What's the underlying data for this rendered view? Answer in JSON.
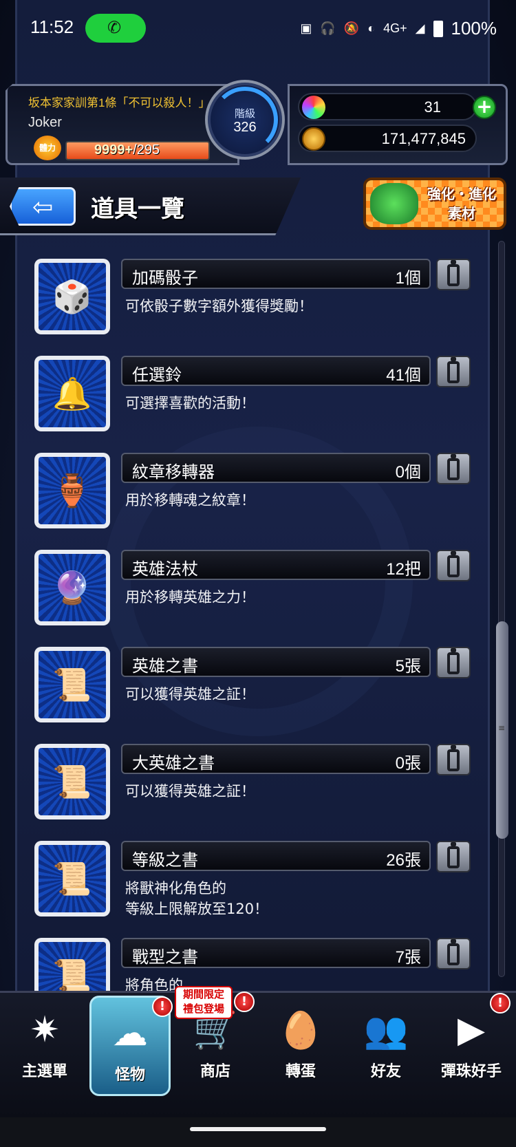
{
  "status_bar": {
    "time": "11:52",
    "battery": "100%",
    "signal_text": "4G+",
    "icons": [
      "call-icon",
      "auto-hd-icon",
      "headphones-icon",
      "mute-bell-icon",
      "volte-icon",
      "signal-icon",
      "battery-icon"
    ]
  },
  "player": {
    "motto": "坂本家家訓第1條「不可以殺人！」",
    "name": "Joker",
    "stamina_icon_text": "體力",
    "stamina_current": "9999+",
    "stamina_max": "/295",
    "rank_label": "階級",
    "rank": "326"
  },
  "resources": {
    "orbs": "31",
    "gold": "171,477,845",
    "plus_label": "+"
  },
  "title_bar": {
    "back_glyph": "⇦",
    "title": "道具一覽"
  },
  "evolve_button": {
    "line1": "強化・進化",
    "line2": "素材"
  },
  "items": [
    {
      "name": "加碼骰子",
      "count": "1個",
      "desc": "可依骰子數字額外獲得獎勵！",
      "icon": "dice-icon",
      "glyph": "🎲"
    },
    {
      "name": "任選鈴",
      "count": "41個",
      "desc": "可選擇喜歡的活動！",
      "icon": "bell-icon",
      "glyph": "🔔"
    },
    {
      "name": "紋章移轉器",
      "count": "0個",
      "desc": "用於移轉魂之紋章！",
      "icon": "emblem-transfer-icon",
      "glyph": "🏺"
    },
    {
      "name": "英雄法杖",
      "count": "12把",
      "desc": "用於移轉英雄之力！",
      "icon": "hero-staff-icon",
      "glyph": "🔮"
    },
    {
      "name": "英雄之書",
      "count": "5張",
      "desc": "可以獲得英雄之証！",
      "icon": "hero-scroll-icon",
      "glyph": "📜"
    },
    {
      "name": "大英雄之書",
      "count": "0張",
      "desc": "可以獲得英雄之証！",
      "icon": "great-hero-scroll-icon",
      "glyph": "📜"
    },
    {
      "name": "等級之書",
      "count": "26張",
      "desc": "將獸神化角色的\n等級上限解放至120！",
      "icon": "level-scroll-icon",
      "glyph": "📜"
    },
    {
      "name": "戰型之書",
      "count": "7張",
      "desc": "將角色的",
      "icon": "battle-type-scroll-icon",
      "glyph": "📜"
    }
  ],
  "nav": {
    "items": [
      {
        "label": "主選單",
        "icon": "main-menu-icon",
        "glyph": "✷"
      },
      {
        "label": "怪物",
        "icon": "monster-icon",
        "glyph": "☁"
      },
      {
        "label": "商店",
        "icon": "shop-cart-icon",
        "glyph": "🛒"
      },
      {
        "label": "轉蛋",
        "icon": "gacha-egg-icon",
        "glyph": "🥚"
      },
      {
        "label": "好友",
        "icon": "friends-icon",
        "glyph": "👥"
      },
      {
        "label": "彈珠好手",
        "icon": "pinball-ace-icon",
        "glyph": "▶"
      }
    ],
    "promo_line1": "期間限定",
    "promo_line2": "禮包登場",
    "alert": "!"
  }
}
